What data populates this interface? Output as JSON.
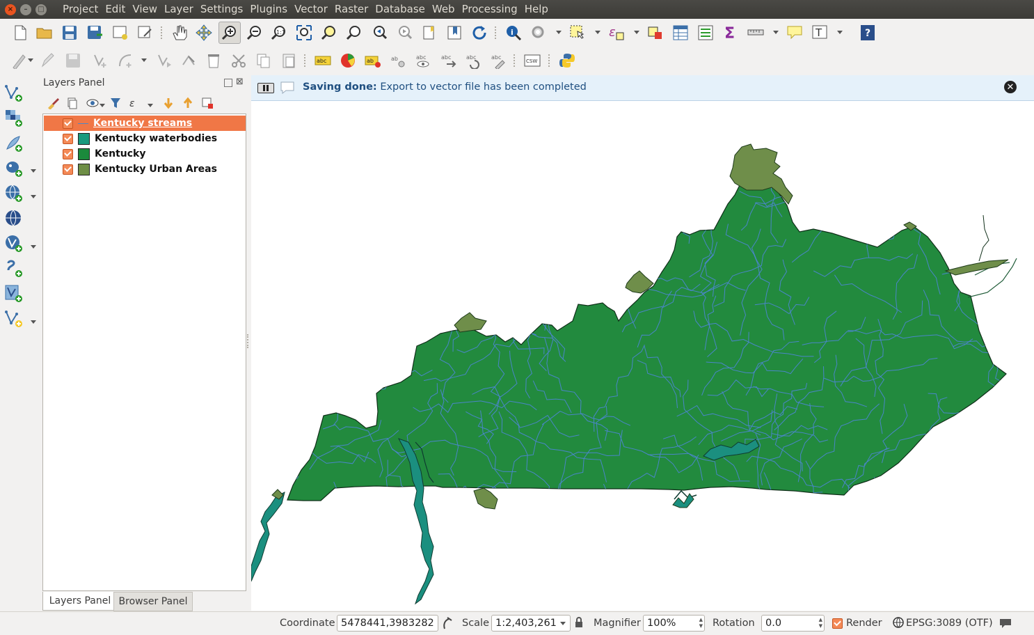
{
  "window": {
    "menu": [
      "Project",
      "Edit",
      "View",
      "Layer",
      "Settings",
      "Plugins",
      "Vector",
      "Raster",
      "Database",
      "Web",
      "Processing",
      "Help"
    ]
  },
  "toolbar2": {
    "csw_label": "CSW"
  },
  "layers_panel": {
    "title": "Layers Panel",
    "layers": [
      {
        "name": "Kentucky streams",
        "checked": true,
        "symbol": "line",
        "color": "#4d87c7",
        "selected": true
      },
      {
        "name": "Kentucky waterbodies",
        "checked": true,
        "symbol": "fill",
        "color": "#1a9a7e",
        "selected": false
      },
      {
        "name": "Kentucky",
        "checked": true,
        "symbol": "fill",
        "color": "#1b8a3c",
        "selected": false
      },
      {
        "name": "Kentucky Urban Areas",
        "checked": true,
        "symbol": "fill",
        "color": "#6e8e46",
        "selected": false
      }
    ],
    "tabs": [
      "Layers Panel",
      "Browser Panel"
    ]
  },
  "message_bar": {
    "title": "Saving done:",
    "text": "Export to vector file has been completed"
  },
  "map": {
    "colors": {
      "state_fill": "#228a3e",
      "streams": "#4a86c9",
      "urban": "#6f8e4a",
      "waterbodies": "#1b8f7f"
    }
  },
  "statusbar": {
    "coordinate_label": "Coordinate",
    "coordinate_value": "5478441,3983282",
    "scale_label": "Scale",
    "scale_value": "1:2,403,261",
    "magnifier_label": "Magnifier",
    "magnifier_value": "100%",
    "rotation_label": "Rotation",
    "rotation_value": "0.0",
    "render_label": "Render",
    "render_checked": true,
    "crs_label": "EPSG:3089 (OTF)"
  }
}
